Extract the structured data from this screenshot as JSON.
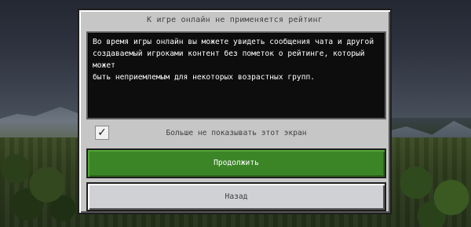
{
  "dialog": {
    "title": "К игре онлайн не применяется рейтинг",
    "message": "Во время игры онлайн вы можете увидеть сообщения чата и другой\nсоздаваемый игроками контент без пометок о рейтинге, который может\nбыть неприемлемым для некоторых возрастных групп.",
    "checkbox": {
      "checked": true,
      "mark": "✓",
      "label": "Больше не показывать этот экран"
    },
    "buttons": {
      "continue_label": "Продолжить",
      "back_label": "Назад"
    }
  },
  "colors": {
    "dialog_bg": "#c6c6c6",
    "message_bg": "#0d0d0d",
    "primary_button": "#3c8527",
    "secondary_button": "#d0d1d4"
  }
}
